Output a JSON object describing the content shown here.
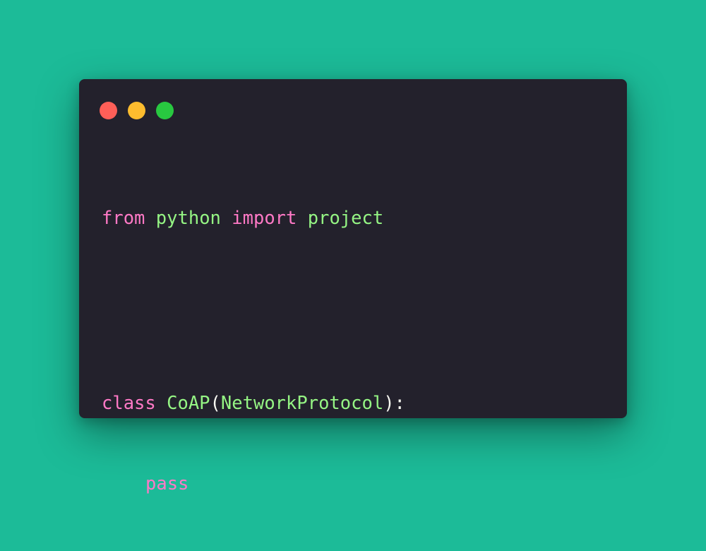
{
  "colors": {
    "background": "#1cbb98",
    "window": "#23212c",
    "keyword": "#ff79c6",
    "identifier": "#95f584",
    "punctuation": "#f8f8f2",
    "close_dot": "#fe5f58",
    "minimize_dot": "#fdbc2e",
    "maximize_dot": "#28c840"
  },
  "window_controls": [
    "close",
    "minimize",
    "maximize"
  ],
  "code": {
    "line1": {
      "kw_from": "from",
      "module": "python",
      "kw_import": "import",
      "name": "project"
    },
    "line2": {
      "kw_class": "class",
      "class_name": "CoAP",
      "open_paren": "(",
      "base_class": "NetworkProtocol",
      "close": "):"
    },
    "line3": {
      "kw_pass": "pass"
    }
  }
}
